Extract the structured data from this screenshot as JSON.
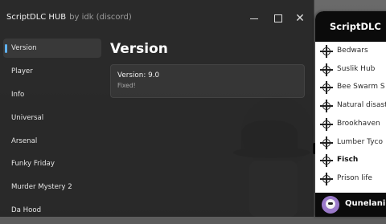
{
  "window": {
    "title": "ScriptDLC HUB",
    "subtitle": "by idk (discord)",
    "controls": {
      "minimize": "—",
      "maximize": "□",
      "close": "✕"
    }
  },
  "sidebar": {
    "items": [
      {
        "label": "Version",
        "active": true
      },
      {
        "label": "Player"
      },
      {
        "label": "Info"
      },
      {
        "label": "Universal"
      },
      {
        "label": "Arsenal"
      },
      {
        "label": "Funky Friday"
      },
      {
        "label": "Murder Mystery 2"
      },
      {
        "label": "Da Hood"
      }
    ]
  },
  "main": {
    "title": "Version",
    "card": {
      "line1": "Version: 9.0",
      "line2": "Fixed!"
    }
  },
  "panel": {
    "title": "ScriptDLC",
    "items": [
      {
        "label": "Bedwars"
      },
      {
        "label": "Suslik Hub"
      },
      {
        "label": "Bee Swarm S"
      },
      {
        "label": "Natural disast"
      },
      {
        "label": "Brookhaven"
      },
      {
        "label": "Lumber Tyco"
      },
      {
        "label": "Fisch",
        "bold": true
      },
      {
        "label": "Prison life"
      }
    ],
    "footer": {
      "username": "Qunelani"
    }
  },
  "colors": {
    "accent": "#5fb2f0",
    "window_bg": "#262626",
    "panel_bg": "#ffffff",
    "panel_header": "#0b0b0b"
  },
  "icons": {
    "panel_item": "crosshair-icon",
    "avatar": "avatar-icon"
  }
}
